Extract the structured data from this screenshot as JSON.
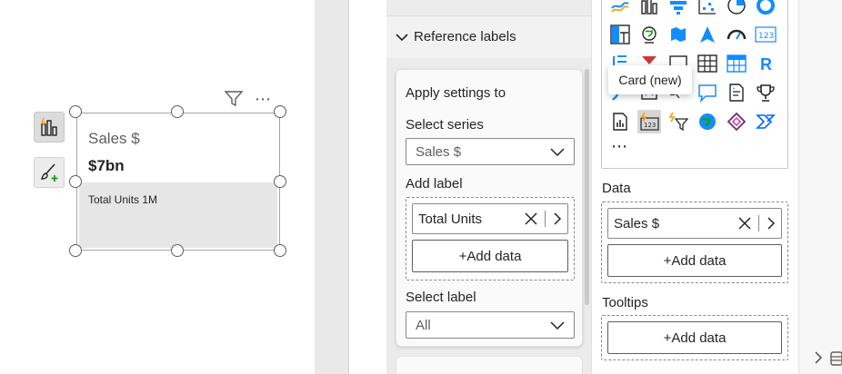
{
  "canvas": {
    "card": {
      "title": "Sales $",
      "value": "$7bn",
      "reference_label": "Total Units 1M"
    },
    "side_tools": {
      "build_icon": "build-visual-icon",
      "format_icon": "format-brush-icon"
    },
    "header_icons": {
      "filter": "filter-icon",
      "more": "more-options-icon",
      "more_text": "⋯"
    }
  },
  "format_pane": {
    "section_title": "Reference labels",
    "apply_settings_title": "Apply settings to",
    "select_series_label": "Select series",
    "select_series_value": "Sales $",
    "add_label_title": "Add label",
    "add_label_chip": "Total Units",
    "add_data_label": "+Add data",
    "select_label_title": "Select label",
    "select_label_value": "All"
  },
  "build_pane": {
    "tooltip": "Card (new)",
    "ellipsis": "⋯",
    "data_title": "Data",
    "data_chip": "Sales $",
    "data_add_label": "+Add data",
    "tooltips_title": "Tooltips",
    "tooltips_add_label": "+Add data",
    "r_visual_text": "R",
    "number_visual_text": "123",
    "accent_color": "#118dff",
    "warning_color": "#f5a623"
  }
}
